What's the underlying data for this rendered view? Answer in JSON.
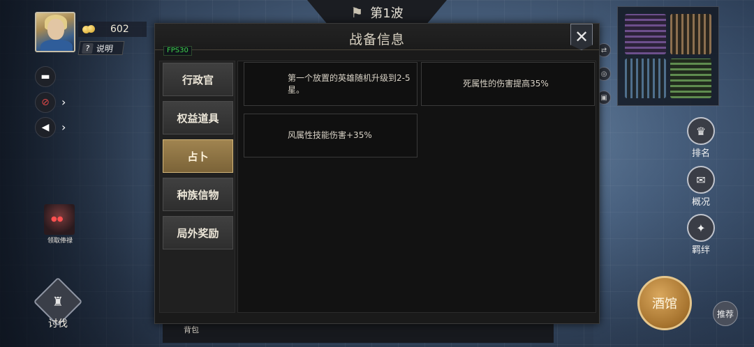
{
  "hud": {
    "wave_label": "第1波",
    "coins": "602",
    "help_label": "说明",
    "reward_label": "领取俸禄",
    "crusade_label": "讨伐",
    "bag_label": "背包"
  },
  "right_menu": {
    "ranking": "排名",
    "overview": "概况",
    "bond": "羁绊",
    "tavern": "酒馆",
    "recommend": "推荐"
  },
  "modal": {
    "title": "战备信息",
    "fps": "FPS30",
    "close_glyph": "✕",
    "tabs": [
      {
        "label": "行政官",
        "active": false
      },
      {
        "label": "权益道具",
        "active": false
      },
      {
        "label": "占卜",
        "active": true
      },
      {
        "label": "种族信物",
        "active": false
      },
      {
        "label": "局外奖励",
        "active": false
      }
    ],
    "cards": [
      {
        "text": "第一个放置的英雄随机升级到2-5星。"
      },
      {
        "text": "死属性的伤害提高35%"
      },
      {
        "text": "风属性技能伤害+35%"
      }
    ]
  },
  "colors": {
    "active_tab": "#a08450",
    "fps_green": "#3fd44b",
    "tavern_gold": "#d9a75d"
  },
  "icons": [
    "flag-icon",
    "coin-icon",
    "question-icon",
    "chat-icon",
    "mic-muted-icon",
    "speaker-icon",
    "close-icon",
    "helmet-icon",
    "ranking-icon",
    "scroll-icon",
    "bond-icon"
  ]
}
